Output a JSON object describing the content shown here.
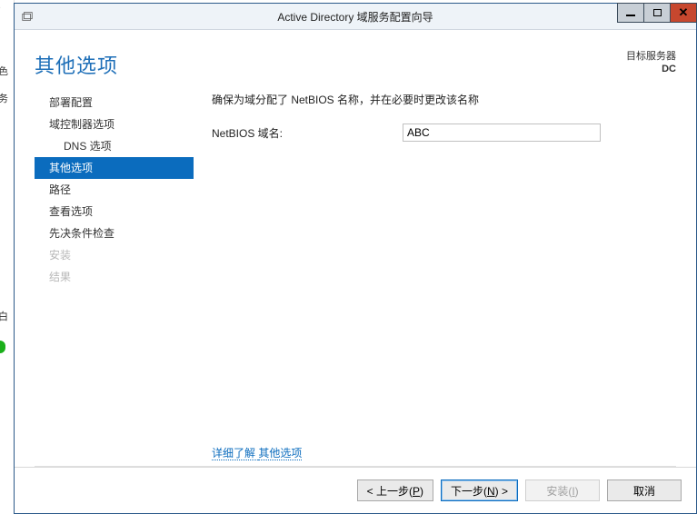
{
  "window": {
    "title": "Active Directory 域服务配置向导"
  },
  "header": {
    "page_title": "其他选项",
    "target_label": "目标服务器",
    "target_value": "DC"
  },
  "nav": {
    "items": [
      {
        "label": "部署配置",
        "indent": false,
        "selected": false,
        "disabled": false
      },
      {
        "label": "域控制器选项",
        "indent": false,
        "selected": false,
        "disabled": false
      },
      {
        "label": "DNS 选项",
        "indent": true,
        "selected": false,
        "disabled": false
      },
      {
        "label": "其他选项",
        "indent": false,
        "selected": true,
        "disabled": false
      },
      {
        "label": "路径",
        "indent": false,
        "selected": false,
        "disabled": false
      },
      {
        "label": "查看选项",
        "indent": false,
        "selected": false,
        "disabled": false
      },
      {
        "label": "先决条件检查",
        "indent": false,
        "selected": false,
        "disabled": false
      },
      {
        "label": "安装",
        "indent": false,
        "selected": false,
        "disabled": true
      },
      {
        "label": "结果",
        "indent": false,
        "selected": false,
        "disabled": true
      }
    ]
  },
  "content": {
    "instruction": "确保为域分配了 NetBIOS 名称，并在必要时更改该名称",
    "netbios_label": "NetBIOS 域名:",
    "netbios_value": "ABC",
    "learn_more_prefix": "详细了解",
    "learn_more_link": "其他选项"
  },
  "footer": {
    "prev": "< 上一步(P)",
    "next": "下一步(N) >",
    "install": "安装(I)",
    "cancel": "取消"
  }
}
